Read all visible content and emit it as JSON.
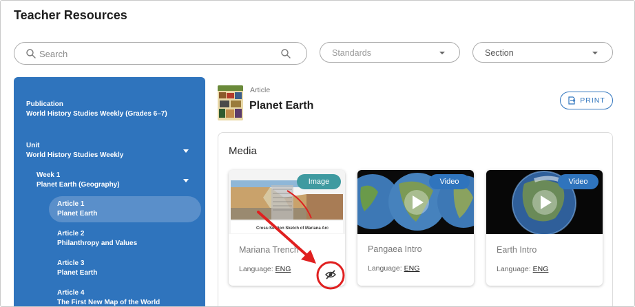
{
  "page": {
    "title": "Teacher Resources"
  },
  "filters": {
    "search_placeholder": "Search",
    "standards_label": "Standards",
    "section_label": "Section"
  },
  "sidebar": {
    "publication": {
      "label": "Publication",
      "value": "World History Studies Weekly (Grades 6–7)"
    },
    "unit": {
      "label": "Unit",
      "value": "World History Studies Weekly"
    },
    "week": {
      "label": "Week 1",
      "value": "Planet Earth (Geography)"
    },
    "articles": [
      {
        "label": "Article 1",
        "value": "Planet Earth",
        "active": true
      },
      {
        "label": "Article 2",
        "value": "Philanthropy and Values",
        "active": false
      },
      {
        "label": "Article 3",
        "value": "Planet Earth",
        "active": false
      },
      {
        "label": "Article 4",
        "value": "The First New Map of the World",
        "active": false
      }
    ]
  },
  "content": {
    "type": "Article",
    "title": "Planet Earth",
    "print_label": "PRINT",
    "media_heading": "Media",
    "language_label": "Language:",
    "cards": [
      {
        "badge": "Image",
        "name": "Mariana Trench",
        "language": "ENG"
      },
      {
        "badge": "Video",
        "name": "Pangaea Intro",
        "language": "ENG"
      },
      {
        "badge": "Video",
        "name": "Earth Intro",
        "language": "ENG"
      }
    ]
  },
  "diagram_text": {
    "caption": "Cross-Section Sketch of Mariana Arc"
  },
  "colors": {
    "sidebar_bg": "#2f74bd",
    "sidebar_active": "#5a8fca",
    "image_badge": "#3f9aa0",
    "video_badge": "#2f74bd",
    "annotation_red": "#e02020"
  },
  "icons": {
    "search": "search-icon",
    "print": "print-icon",
    "hidden": "eye-slash-icon",
    "play": "play-icon"
  }
}
